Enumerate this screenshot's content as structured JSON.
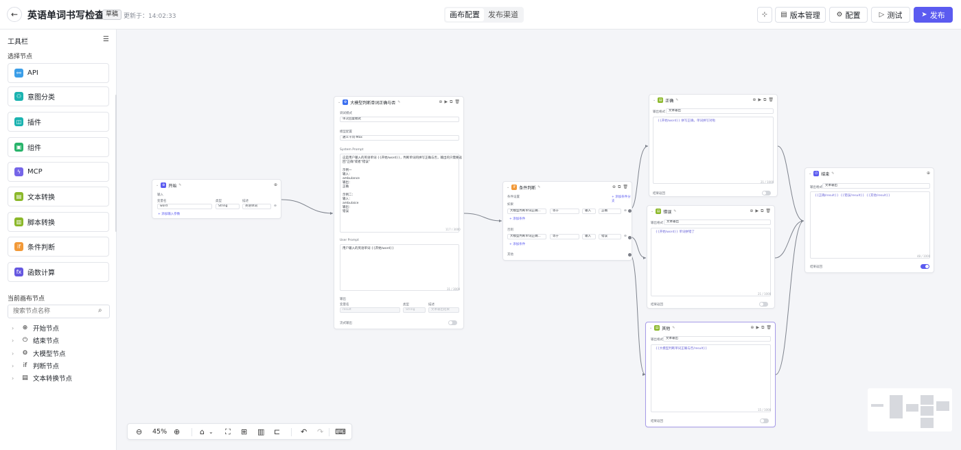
{
  "header": {
    "back_icon": "arrow-left-icon",
    "title": "英语单词书写检查",
    "draft_badge": "草稿",
    "updated_label": "更新于：",
    "updated_time": "14:02:33",
    "tabs": [
      "画布配置",
      "发布渠道"
    ],
    "active_tab": 0,
    "version_label": "版本管理",
    "config_label": "配置",
    "test_label": "测试",
    "publish_label": "发布",
    "accent": "#5b5bf0"
  },
  "sidebar": {
    "title": "工具栏",
    "select_nodes_label": "选择节点",
    "tools": [
      {
        "label": "API",
        "icon": "api-icon",
        "color": "#3b9ee8"
      },
      {
        "label": "意图分类",
        "icon": "intent-icon",
        "color": "#1bb3b0"
      },
      {
        "label": "插件",
        "icon": "plugin-icon",
        "color": "#1bb3b0"
      },
      {
        "label": "组件",
        "icon": "component-icon",
        "color": "#28b36a"
      },
      {
        "label": "MCP",
        "icon": "mcp-icon",
        "color": "#7565e8"
      },
      {
        "label": "文本转换",
        "icon": "text-transform-icon",
        "color": "#8bb82a"
      },
      {
        "label": "脚本转换",
        "icon": "script-icon",
        "color": "#8bb82a"
      },
      {
        "label": "条件判断",
        "icon": "condition-icon",
        "color": "#f29938"
      },
      {
        "label": "函数计算",
        "icon": "function-icon",
        "color": "#6557e0"
      }
    ],
    "current_nodes_label": "当前画布节点",
    "search_placeholder": "搜索节点名称",
    "tree": [
      {
        "label": "开始节点",
        "icon": "start-icon"
      },
      {
        "label": "结束节点",
        "icon": "power-icon"
      },
      {
        "label": "大模型节点",
        "icon": "llm-icon"
      },
      {
        "label": "判断节点",
        "icon": "if-icon"
      },
      {
        "label": "文本转换节点",
        "icon": "text-node-icon"
      }
    ]
  },
  "nodes": {
    "start": {
      "title": "开始",
      "input_label": "输入",
      "col_var": "变量名",
      "col_type": "类型",
      "col_desc": "描述",
      "var_name": "word",
      "var_type": "String",
      "var_desc": "英语单词",
      "add_label": "+ 添加输入参数"
    },
    "llm": {
      "title": "大模型判断单词正确与否",
      "mode_label": "调试模式",
      "mode_value": "单次回复模式",
      "model_label": "模型配置",
      "model_value": "通义千问-Max",
      "system_prompt_label": "System Prompt",
      "system_prompt": "这是用户输入的英语单词 {{开始/word}}，判断单词的拼写正确与否，输出的只需要返\n回\"正确\"或者\"错误\"\n\n示例一\n输入：\nambulance\n输出：\n正确\n\n示例二：\n输入：\nambulaice\n输出：\n错误",
      "system_count": "117 / 3000",
      "user_prompt_label": "User Prompt",
      "user_prompt": "用户输入的英语单词 {{开始/word}}",
      "user_count": "31 / 3000",
      "output_label": "输出",
      "out_col_var": "变量名",
      "out_col_type": "类型",
      "out_col_desc": "描述",
      "out_var": "result",
      "out_type": "String",
      "out_desc": "文本输出结果",
      "stream_label": "流式输出"
    },
    "condition": {
      "title": "条件判断",
      "settings_label": "条件设置",
      "add_branch_label": "+ 添加条件分支",
      "if_label": "如果",
      "elif_label": "否则",
      "else_label": "其他",
      "var1": "大模型判断单词正确...",
      "op1": "等于",
      "type1": "输入",
      "val1": "正确",
      "var2": "大模型判断单词正确...",
      "op2": "等于",
      "type2": "输入",
      "val2": "错误",
      "add_cond_label": "+ 添加条件"
    },
    "correct": {
      "title": "正确",
      "format_label": "输出格式",
      "format_value": "文本输出",
      "content": "{{开始/word}} 拼写正确，单词拼写对啦",
      "count": "21 / 1000",
      "stream_label": "结果返回"
    },
    "wrong": {
      "title": "错误",
      "format_label": "输出格式",
      "format_value": "文本输出",
      "content": "{{开始/word}} 单词拼错了",
      "count": "21 / 1000",
      "stream_label": "结果返回"
    },
    "other": {
      "title": "其他",
      "format_label": "输出格式",
      "format_value": "文本输出",
      "content": "{{大模型判断单词正确与否/result}}",
      "count": "15 / 1000",
      "stream_label": "结果返回"
    },
    "end": {
      "title": "结束",
      "format_label": "输出格式",
      "format_value": "文本输出",
      "content": "{{正确/result}}  {{错误/result}}  {{其他/result}}",
      "count": "48 / 1000",
      "stream_label": "结果返回"
    }
  },
  "bottom_toolbar": {
    "zoom": "45%"
  }
}
